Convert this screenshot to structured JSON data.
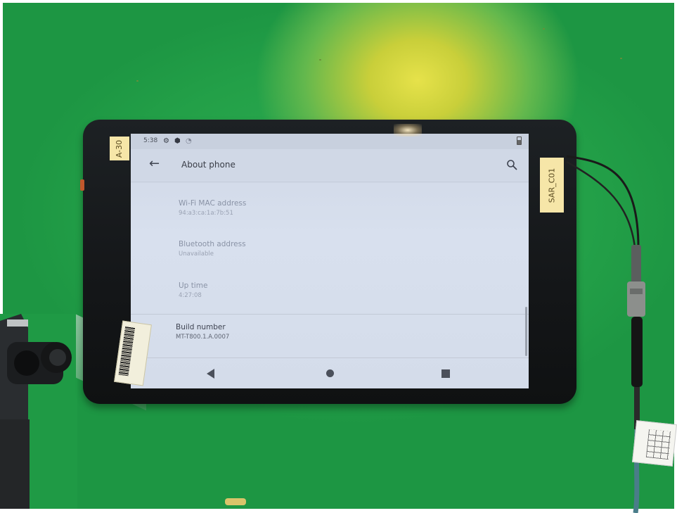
{
  "device": {
    "status_bar": {
      "time": "5:38"
    },
    "app_bar": {
      "title": "About phone"
    },
    "preferences": [
      {
        "title": "Wi-Fi MAC address",
        "summary": "94:a3:ca:1a:7b:51"
      },
      {
        "title": "Bluetooth address",
        "summary": "Unavailable"
      },
      {
        "title": "Up time",
        "summary": "4:27:08"
      },
      {
        "title": "Build number",
        "summary": "MT-T800.1.A.0007"
      }
    ]
  },
  "stickers": {
    "left": "A-30",
    "right": "SAR_C01"
  },
  "colors": {
    "background_green": "#23a048",
    "tablet_bezel": "#141618",
    "screen": "#d4dcea",
    "sticker": "#f6e6a8"
  }
}
